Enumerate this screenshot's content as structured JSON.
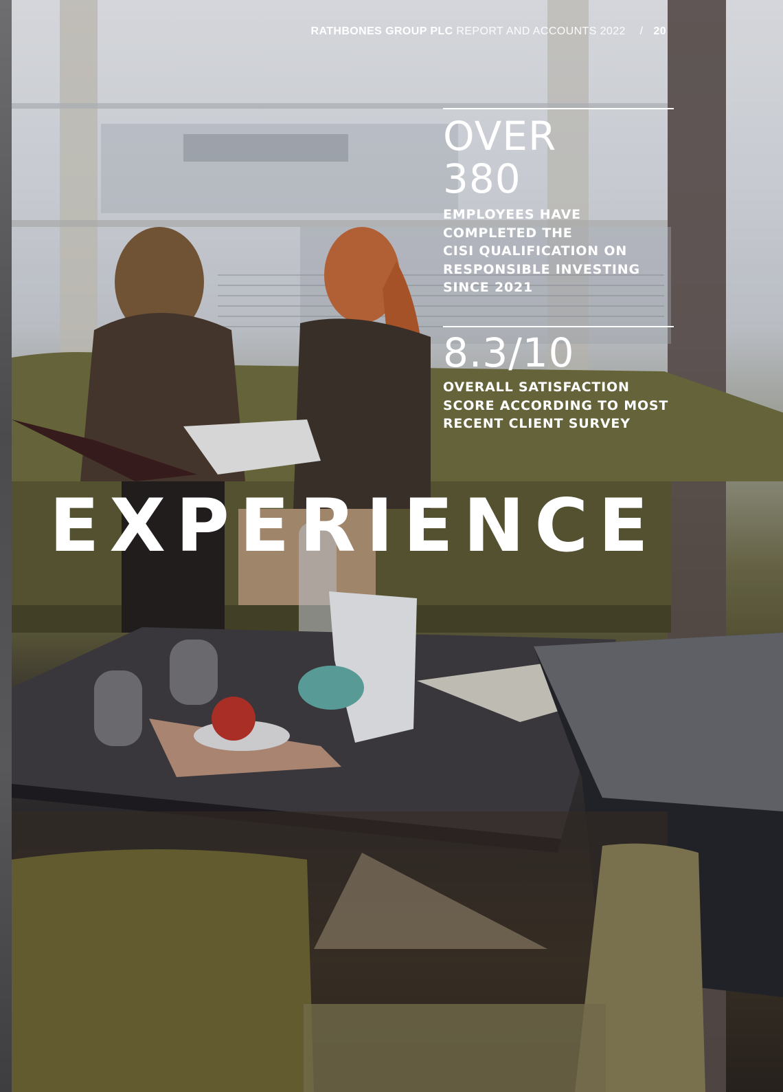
{
  "header": {
    "company": "RATHBONES GROUP PLC",
    "report": "REPORT AND ACCOUNTS 2022",
    "separator": "/",
    "page_number": "20"
  },
  "stats": [
    {
      "value_line1": "OVER",
      "value_line2": "380",
      "description": [
        "EMPLOYEES HAVE",
        "COMPLETED THE",
        "CISI QUALIFICATION ON",
        "RESPONSIBLE INVESTING",
        "SINCE 2021"
      ]
    },
    {
      "value": "8.3/10",
      "description": [
        "OVERALL SATISFACTION",
        "SCORE ACCORDING TO MOST",
        "RECENT CLIENT SURVEY"
      ]
    }
  ],
  "hero_word": "EXPERIENCE",
  "colors": {
    "text": "#ffffff",
    "sofa": "#6b6a3c",
    "table": "#3a3838"
  }
}
